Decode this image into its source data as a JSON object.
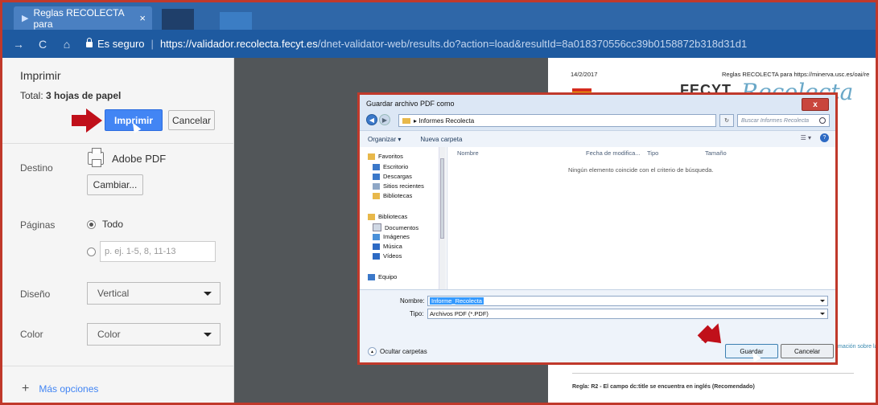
{
  "browser": {
    "tab_title": "Reglas RECOLECTA para",
    "tab_close": "×",
    "secure_label": "Es seguro",
    "url_host": "https://validador.recolecta.fecyt.es",
    "url_path": "/dnet-validator-web/results.do?action=load&resultId=8a018370556cc39b0158872b318d31d1"
  },
  "print_panel": {
    "title": "Imprimir",
    "total_prefix": "Total:",
    "total_value": "3 hojas de papel",
    "print_button": "Imprimir",
    "cancel_button": "Cancelar",
    "destination_label": "Destino",
    "destination_name": "Adobe PDF",
    "change_button": "Cambiar...",
    "pages_label": "Páginas",
    "pages_all": "Todo",
    "pages_range_placeholder": "p. ej. 1-5, 8, 11-13",
    "layout_label": "Diseño",
    "layout_value": "Vertical",
    "color_label": "Color",
    "color_value": "Color",
    "more_options": "Más opciones"
  },
  "preview": {
    "date": "14/2/2017",
    "header_title": "Reglas RECOLECTA para https://minerva.usc.es/oai/re",
    "logo_fecyt": "FECYT",
    "logo_recolecta": "Recolecta",
    "info_link": "mación sobre la",
    "rule_text": "Regla:  R2 - El campo dc:title se encuentra en inglés (Recomendado)"
  },
  "save_dialog": {
    "title": "Guardar archivo PDF como",
    "close": "x",
    "path": "Informes Recolecta",
    "search_placeholder": "Buscar Informes Recolecta",
    "organize": "Organizar ▾",
    "new_folder": "Nueva carpeta",
    "nav_items": [
      {
        "label": "Favoritos",
        "color": "#e8b84a"
      },
      {
        "label": "Escritorio",
        "color": "#3b78c9"
      },
      {
        "label": "Descargas",
        "color": "#3b78c9"
      },
      {
        "label": "Sitios recientes",
        "color": "#8fa7c6"
      },
      {
        "label": "Bibliotecas",
        "color": "#e8b84a"
      },
      {
        "label": "Bibliotecas",
        "color": "#e8b84a"
      },
      {
        "label": "Documentos",
        "color": "#d0d8e4"
      },
      {
        "label": "Imágenes",
        "color": "#4a90d9"
      },
      {
        "label": "Música",
        "color": "#2d6ac4"
      },
      {
        "label": "Vídeos",
        "color": "#2d6ac4"
      },
      {
        "label": "Equipo",
        "color": "#3b78c9"
      }
    ],
    "columns": [
      "Nombre",
      "Fecha de modifica...",
      "Tipo",
      "Tamaño"
    ],
    "empty_message": "Ningún elemento coincide con el criterio de búsqueda.",
    "name_label": "Nombre:",
    "name_value": "Informe_Recolecta",
    "type_label": "Tipo:",
    "type_value": "Archivos PDF (*.PDF)",
    "hide_folders": "Ocultar carpetas",
    "save_button": "Guardar",
    "cancel_button": "Cancelar"
  },
  "colors": {
    "accent_blue": "#4285f4",
    "annotation_red": "#c0101a",
    "frame_red": "#c0392b"
  }
}
